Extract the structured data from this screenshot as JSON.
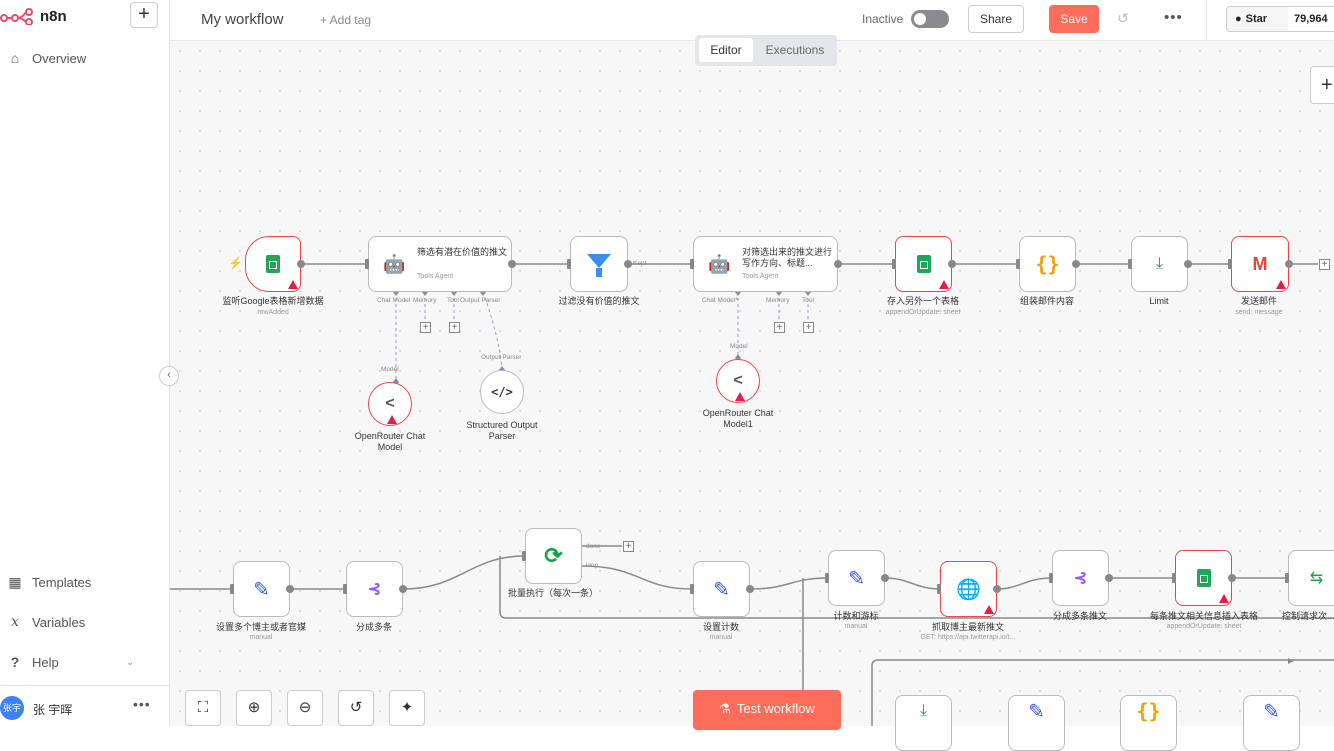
{
  "sidebar": {
    "brand": "n8n",
    "add_label": "+",
    "nav": [
      {
        "label": "Overview",
        "icon": "home-icon"
      },
      {
        "label": "Templates",
        "icon": "templates-icon"
      },
      {
        "label": "Variables",
        "icon": "variables-icon"
      },
      {
        "label": "Help",
        "icon": "help-icon"
      }
    ],
    "user": {
      "avatar_text": "张宇",
      "name": "张 宇晖",
      "menu": "•••"
    }
  },
  "header": {
    "workflow_name": "My workflow",
    "add_tag": "+ Add tag",
    "status_label": "Inactive",
    "share": "Share",
    "save": "Save",
    "more": "•••",
    "github": {
      "star_label": "Star",
      "count": "79,964"
    }
  },
  "tabs": {
    "editor": "Editor",
    "executions": "Executions"
  },
  "nodes": {
    "trigger": {
      "label": "监听Google表格新增数据",
      "sub": "rowAdded"
    },
    "agent1": {
      "title": "筛选有潜在价值的推文",
      "sub": "Tools Agent",
      "ports": [
        "Chat Model",
        "Memory",
        "Tool",
        "Output Parser"
      ]
    },
    "filter": {
      "label": "过滤没有价值的推文",
      "out": "Kept"
    },
    "agent2": {
      "title": "对筛选出来的推文进行写作方向、标题...",
      "sub": "Tools Agent",
      "ports": [
        "Chat Model*",
        "Memory",
        "Tool"
      ]
    },
    "sheet2": {
      "label": "存入另外一个表格",
      "sub": "appendOrUpdate: sheet"
    },
    "code": {
      "label": "组装邮件内容"
    },
    "limit": {
      "label": "Limit"
    },
    "gmail": {
      "label": "发送邮件",
      "sub": "send: message"
    },
    "model1": {
      "label": "OpenRouter Chat Model",
      "port": "Model"
    },
    "parser": {
      "label": "Structured Output Parser",
      "port": "Output Parser"
    },
    "model2": {
      "label": "OpenRouter Chat Model1",
      "port": "Model"
    },
    "set1": {
      "label": "设置多个博主或者官媒",
      "sub": "manual"
    },
    "split1": {
      "label": "分成多条"
    },
    "batch": {
      "label": "批量执行（每次一条）",
      "out_done": "done",
      "out_loop": "loop"
    },
    "set2": {
      "label": "设置计数",
      "sub": "manual"
    },
    "set3": {
      "label": "计数和游标",
      "sub": "manual"
    },
    "http": {
      "label": "抓取博主最新推文",
      "sub": "GET: https://api.twitterapi.io/t..."
    },
    "split2": {
      "label": "分成多条推文"
    },
    "sheet3": {
      "label": "每条推文相关信息插入表格",
      "sub": "appendOrUpdate: sheet"
    },
    "switch": {
      "label": "控制请求次..."
    }
  },
  "controls": {
    "test_workflow": "Test workflow"
  },
  "colors": {
    "accent": "#ff6d5a",
    "error": "#ef4444",
    "sheets": "#22a559"
  }
}
